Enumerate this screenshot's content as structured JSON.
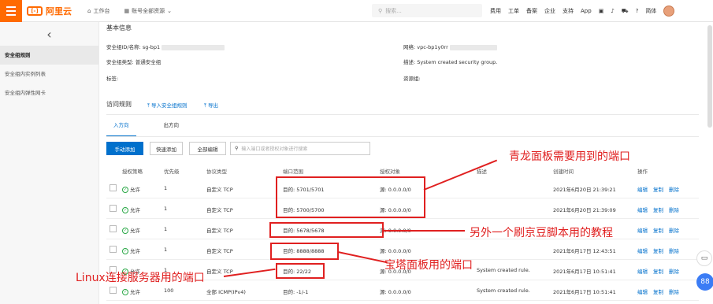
{
  "topbar": {
    "logo": "阿里云",
    "workbench": "工作台",
    "resource": "账号全部资源",
    "search_placeholder": "搜索...",
    "menu": [
      "费用",
      "工单",
      "备案",
      "企业",
      "支持",
      "App"
    ],
    "lang": "简体"
  },
  "sidebar": {
    "items": [
      "安全组规则",
      "安全组内实例列表",
      "安全组内弹性网卡"
    ]
  },
  "basic": {
    "title": "基本信息",
    "id_label": "安全组ID/名称:",
    "id_value": "sg-bp1",
    "type_label": "安全组类型:",
    "type_value": "普通安全组",
    "tag_label": "标签:",
    "network_label": "网络:",
    "network_value": "vpc-bp1y0rr",
    "desc_label": "描述:",
    "desc_value": "System created security group.",
    "rg_label": "资源组:"
  },
  "rules": {
    "title": "访问规则",
    "import": "导入安全组规则",
    "export": "导出",
    "tabs": [
      "入方向",
      "出方向"
    ],
    "buttons": [
      "手动添加",
      "快速添加",
      "全部编辑"
    ],
    "search_placeholder": "输入端口或者授权对象进行搜索",
    "headers": [
      "授权策略",
      "优先级",
      "协议类型",
      "端口范围",
      "授权对象",
      "描述",
      "创建时间",
      "操作"
    ],
    "rows": [
      {
        "policy": "允许",
        "priority": "1",
        "protocol": "自定义 TCP",
        "port": "目的: 5701/5701",
        "source": "源: 0.0.0.0/0",
        "desc": "",
        "time": "2021年6月20日 21:39:21"
      },
      {
        "policy": "允许",
        "priority": "1",
        "protocol": "自定义 TCP",
        "port": "目的: 5700/5700",
        "source": "源: 0.0.0.0/0",
        "desc": "",
        "time": "2021年6月20日 21:39:09"
      },
      {
        "policy": "允许",
        "priority": "1",
        "protocol": "自定义 TCP",
        "port": "目的: 5678/5678",
        "source": "源: 0.0.0.0/0",
        "desc": "",
        "time": ""
      },
      {
        "policy": "允许",
        "priority": "1",
        "protocol": "自定义 TCP",
        "port": "目的: 8888/8888",
        "source": "源: 0.0.0.0/0",
        "desc": "",
        "time": "2021年6月17日 12:43:51"
      },
      {
        "policy": "允许",
        "priority": "1",
        "protocol": "自定义 TCP",
        "port": "目的: 22/22",
        "source": "源: 0.0.0.0/0",
        "desc": "System created rule.",
        "time": "2021年6月17日 10:51:41"
      },
      {
        "policy": "允许",
        "priority": "100",
        "protocol": "全部 ICMP(IPv4)",
        "port": "目的: -1/-1",
        "source": "源: 0.0.0.0/0",
        "desc": "System created rule.",
        "time": "2021年6月17日 10:51:41"
      }
    ],
    "actions": [
      "编辑",
      "复制",
      "删除"
    ]
  },
  "annotations": {
    "qinglong": "青龙面板需要用到的端口",
    "jd": "另外一个刷京豆脚本用的教程",
    "baota": "宝塔面板用的端口",
    "linux": "Linux连接服务器用的端口"
  }
}
